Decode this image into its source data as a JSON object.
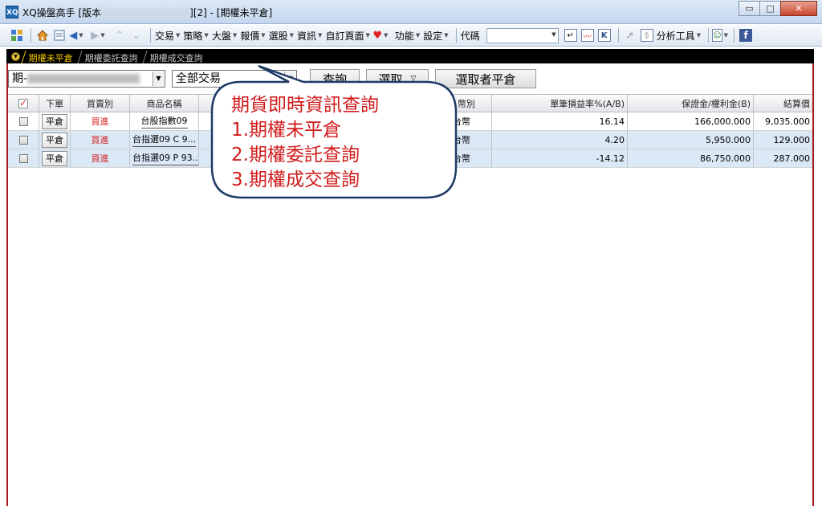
{
  "titlebar": {
    "app_title_prefix": "XQ操盤高手 [版本",
    "app_title_suffix": "][2] - [期權未平倉]",
    "logo_text": "XQ",
    "minimize": "▭",
    "maximize": "□",
    "close": "✕"
  },
  "toolbar": {
    "menus": [
      "交易",
      "策略",
      "大盤",
      "報價",
      "選股",
      "資訊",
      "自訂頁面",
      "功能",
      "設定"
    ],
    "code_label": "代碼",
    "analysis_tools": "分析工具"
  },
  "tabs": [
    {
      "label": "期權未平倉",
      "active": true
    },
    {
      "label": "期權委託查詢",
      "active": false
    },
    {
      "label": "期權成交查詢",
      "active": false
    }
  ],
  "querybar": {
    "account_prefix": "期-",
    "trade_filter": "全部交易",
    "query_button": "查詢",
    "select_button": "選取",
    "select_close_button": "選取者平倉"
  },
  "grid": {
    "columns": [
      "下單",
      "買賣別",
      "商品名稱",
      "幣別",
      "單筆損益率%(A/B)",
      "保證金/權利金(B)",
      "結算價"
    ],
    "rows": [
      {
        "action": "平倉",
        "side": "買進",
        "product": "台股指數09",
        "currency": "新台幣",
        "ratio": "16.14",
        "margin": "166,000.000",
        "settle": "9,035.000"
      },
      {
        "action": "平倉",
        "side": "買進",
        "product": "台指選09 C 9...",
        "currency": "新台幣",
        "ratio": "4.20",
        "margin": "5,950.000",
        "settle": "129.000"
      },
      {
        "action": "平倉",
        "side": "買進",
        "product": "台指選09 P 93...",
        "currency": "新台幣",
        "ratio": "-14.12",
        "margin": "86,750.000",
        "settle": "287.000"
      }
    ]
  },
  "callout": {
    "title": "期貨即時資訊查詢",
    "items": [
      "1.期權未平倉",
      "2.期權委託查詢",
      "3.期權成交查詢"
    ]
  }
}
